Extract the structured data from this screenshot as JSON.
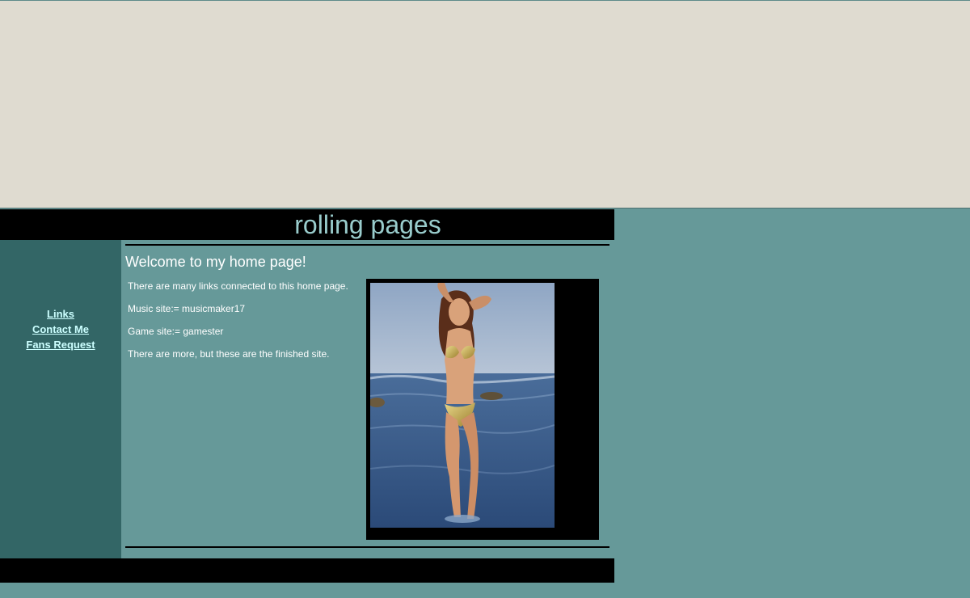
{
  "header": {
    "title": "rolling pages"
  },
  "sidebar": {
    "links": [
      {
        "label": "Links"
      },
      {
        "label": "Contact Me"
      },
      {
        "label": "Fans Request"
      }
    ]
  },
  "main": {
    "heading": "Welcome to my home page!",
    "paragraphs": [
      "There are many links connected to this home page.",
      "Music site:= musicmaker17",
      "Game site:= gamester",
      "There are more, but these are the finished site."
    ]
  },
  "colors": {
    "banner": "#dfdbd0",
    "page_bg": "#669999",
    "sidebar_bg": "#336666",
    "title_text": "#99cccc",
    "link_text": "#ccffff"
  }
}
